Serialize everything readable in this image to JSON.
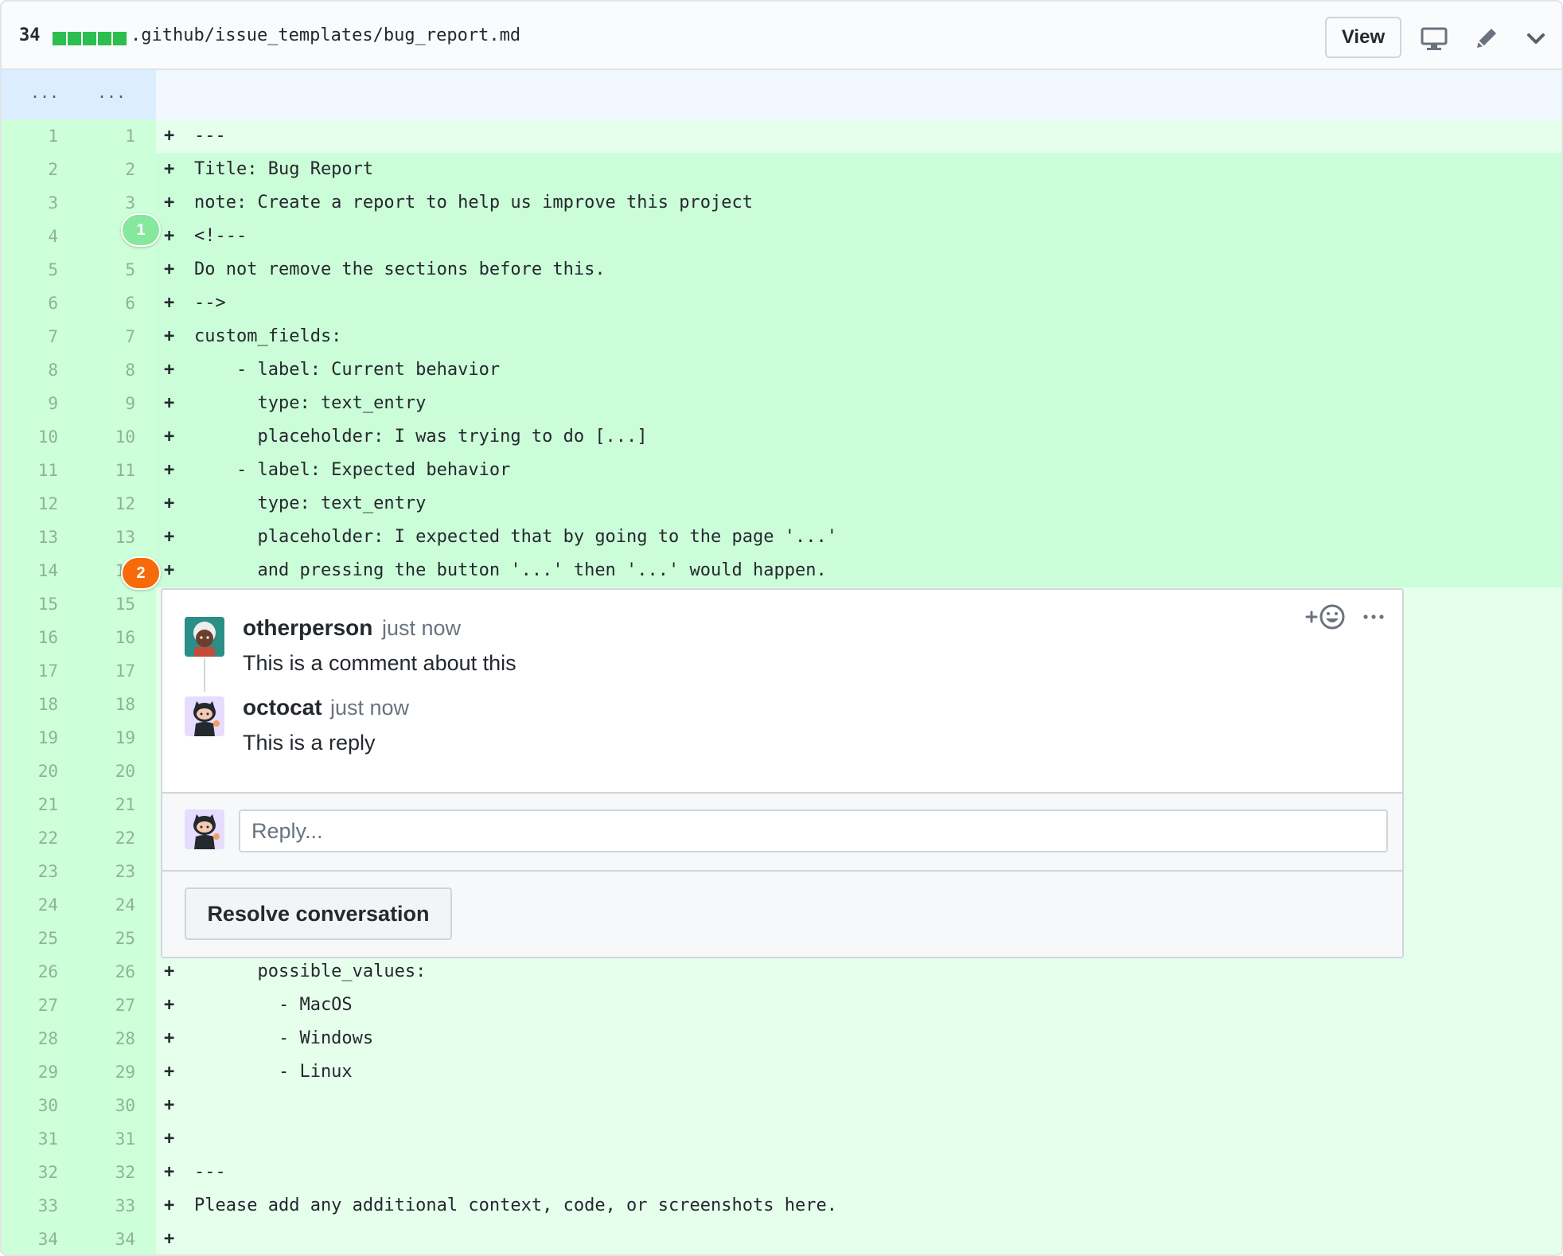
{
  "file": {
    "change_count": "34",
    "diffstat_blocks": 5,
    "path": ".github/issue_templates/bug_report.md",
    "view_label": "View",
    "icons": [
      "display-icon",
      "pencil-icon",
      "chevron-down-icon"
    ]
  },
  "hunk": {
    "old_dots": "...",
    "new_dots": "...",
    "color": "#dbedff"
  },
  "lines": [
    {
      "old": "1",
      "new": "1",
      "sign": "+",
      "text": "---",
      "hl": false
    },
    {
      "old": "2",
      "new": "2",
      "sign": "+",
      "text": "Title: Bug Report",
      "hl": true
    },
    {
      "old": "3",
      "new": "3",
      "sign": "+",
      "text": "note: Create a report to help us improve this project",
      "hl": true
    },
    {
      "old": "4",
      "new": "4",
      "sign": "+",
      "text": "<!---",
      "hl": true
    },
    {
      "old": "5",
      "new": "5",
      "sign": "+",
      "text": "Do not remove the sections before this.",
      "hl": true
    },
    {
      "old": "6",
      "new": "6",
      "sign": "+",
      "text": "-->",
      "hl": true
    },
    {
      "old": "7",
      "new": "7",
      "sign": "+",
      "text": "custom_fields:",
      "hl": true
    },
    {
      "old": "8",
      "new": "8",
      "sign": "+",
      "text": "    - label: Current behavior",
      "hl": true
    },
    {
      "old": "9",
      "new": "9",
      "sign": "+",
      "text": "      type: text_entry",
      "hl": true
    },
    {
      "old": "10",
      "new": "10",
      "sign": "+",
      "text": "      placeholder: I was trying to do [...]",
      "hl": true
    },
    {
      "old": "11",
      "new": "11",
      "sign": "+",
      "text": "    - label: Expected behavior",
      "hl": true
    },
    {
      "old": "12",
      "new": "12",
      "sign": "+",
      "text": "      type: text_entry",
      "hl": true
    },
    {
      "old": "13",
      "new": "13",
      "sign": "+",
      "text": "      placeholder: I expected that by going to the page '...'",
      "hl": true
    },
    {
      "old": "14",
      "new": "14",
      "sign": "+",
      "text": "      and pressing the button '...' then '...' would happen.",
      "hl": true
    },
    {
      "old": "15",
      "new": "15",
      "sign": "",
      "text": "",
      "hl": false
    },
    {
      "old": "16",
      "new": "16",
      "sign": "",
      "text": "",
      "hl": false
    },
    {
      "old": "17",
      "new": "17",
      "sign": "",
      "text": "",
      "hl": false
    },
    {
      "old": "18",
      "new": "18",
      "sign": "",
      "text": "",
      "hl": false
    },
    {
      "old": "19",
      "new": "19",
      "sign": "",
      "text": "",
      "hl": false
    },
    {
      "old": "20",
      "new": "20",
      "sign": "",
      "text": "",
      "hl": false
    },
    {
      "old": "21",
      "new": "21",
      "sign": "",
      "text": "",
      "hl": false
    },
    {
      "old": "22",
      "new": "22",
      "sign": "",
      "text": "",
      "hl": false
    },
    {
      "old": "23",
      "new": "23",
      "sign": "",
      "text": "",
      "hl": false
    },
    {
      "old": "24",
      "new": "24",
      "sign": "",
      "text": "",
      "hl": false
    },
    {
      "old": "25",
      "new": "25",
      "sign": "",
      "text": "",
      "hl": false
    },
    {
      "old": "26",
      "new": "26",
      "sign": "+",
      "text": "      possible_values:",
      "hl": false
    },
    {
      "old": "27",
      "new": "27",
      "sign": "+",
      "text": "        - MacOS",
      "hl": false
    },
    {
      "old": "28",
      "new": "28",
      "sign": "+",
      "text": "        - Windows",
      "hl": false
    },
    {
      "old": "29",
      "new": "29",
      "sign": "+",
      "text": "        - Linux",
      "hl": false
    },
    {
      "old": "30",
      "new": "30",
      "sign": "+",
      "text": "",
      "hl": false
    },
    {
      "old": "31",
      "new": "31",
      "sign": "+",
      "text": "",
      "hl": false
    },
    {
      "old": "32",
      "new": "32",
      "sign": "+",
      "text": "---",
      "hl": false
    },
    {
      "old": "33",
      "new": "33",
      "sign": "+",
      "text": "Please add any additional context, code, or screenshots here.",
      "hl": false
    },
    {
      "old": "34",
      "new": "34",
      "sign": "+",
      "text": "",
      "hl": false
    }
  ],
  "markers": [
    {
      "label": "1",
      "color": "#85e89d"
    },
    {
      "label": "2",
      "color": "#f66a0a"
    }
  ],
  "thread": {
    "comments": [
      {
        "author": "otherperson",
        "time": "just now",
        "body": "This is a comment about this"
      },
      {
        "author": "octocat",
        "time": "just now",
        "body": "This is a reply"
      }
    ],
    "reply_placeholder": "Reply...",
    "resolve_label": "Resolve conversation",
    "icons": [
      "add-reaction-icon",
      "more-icon"
    ]
  },
  "colors": {
    "addition_gutter": "#cdffd8",
    "addition_line": "#e6ffed",
    "selected_line": "#ccfdd9",
    "diffstat": "#2cbe4e"
  }
}
